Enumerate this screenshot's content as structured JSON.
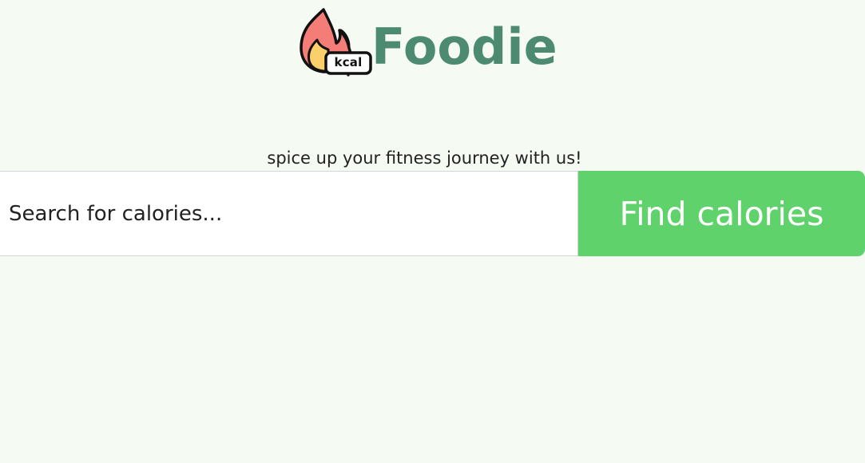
{
  "logo": {
    "icon_name": "flame-kcal-icon",
    "badge_text": "kcal",
    "brand_name": "Foodie",
    "brand_color": "#4d8a72"
  },
  "tagline": "spice up your fitness journey with us!",
  "search": {
    "placeholder": "Search for calories...",
    "value": ""
  },
  "find_button": {
    "label": "Find calories",
    "color": "#5fd26c"
  },
  "background_color": "#f5faf3"
}
